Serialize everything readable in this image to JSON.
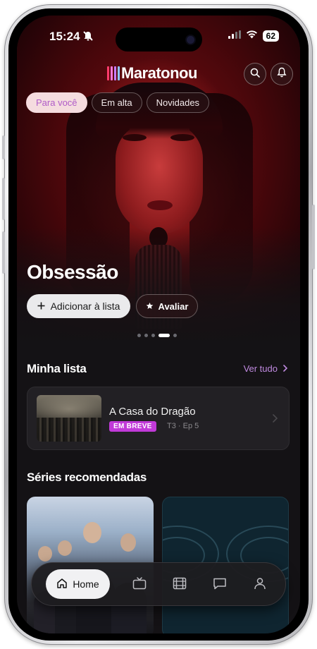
{
  "status_bar": {
    "time": "15:24",
    "battery": "62",
    "icons": [
      "bell-slash-icon",
      "signal-icon",
      "wifi-icon",
      "battery-icon"
    ]
  },
  "header": {
    "logo_text": "Maratonou",
    "logo_bar_colors": [
      "#ff3b6b",
      "#ff7ad9",
      "#c77dff",
      "#8ec5ff"
    ],
    "icons": [
      "search-icon",
      "bell-icon"
    ]
  },
  "chips": [
    {
      "label": "Para você",
      "active": true
    },
    {
      "label": "Em alta",
      "active": false
    },
    {
      "label": "Novidades",
      "active": false
    }
  ],
  "hero": {
    "title": "Obsessão",
    "add_label": "Adicionar à lista",
    "rate_label": "Avaliar",
    "carousel_count": 5,
    "carousel_active_index": 3
  },
  "my_list": {
    "title": "Minha lista",
    "see_all": "Ver tudo",
    "items": [
      {
        "title": "A Casa do Dragão",
        "badge": "EM BREVE",
        "meta": "T3 · Ep 5"
      }
    ]
  },
  "recommended": {
    "title": "Séries recomendadas"
  },
  "tabbar": {
    "home_label": "Home",
    "icons": [
      "home-icon",
      "tv-icon",
      "film-icon",
      "chat-icon",
      "profile-icon"
    ]
  },
  "colors": {
    "accent": "#c08ae0",
    "badge": "#c13ad8",
    "background": "#141215"
  }
}
